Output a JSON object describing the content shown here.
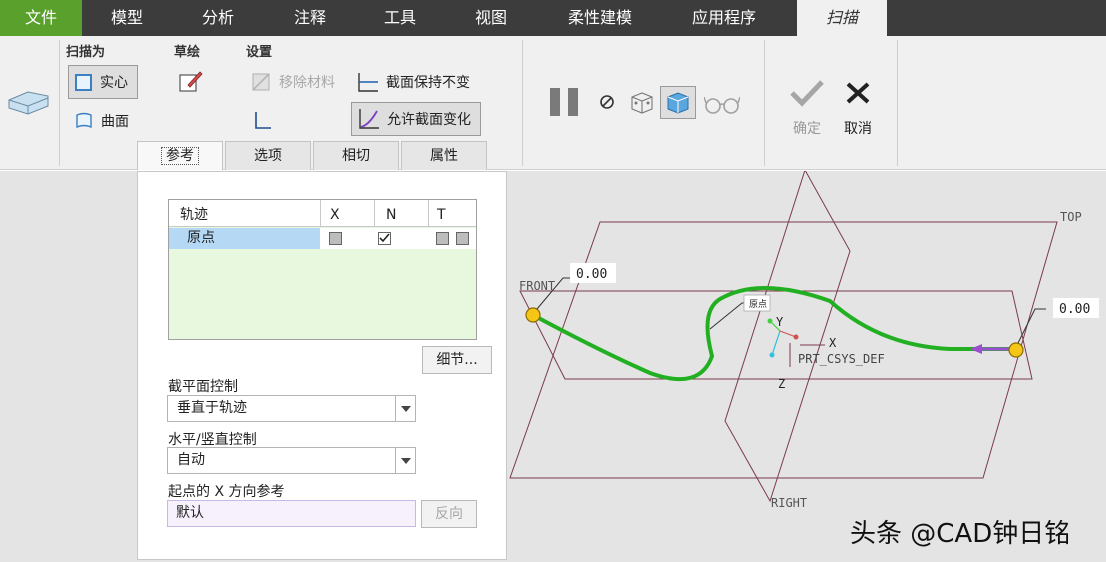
{
  "menu": {
    "file": "文件",
    "tabs": [
      "模型",
      "分析",
      "注释",
      "工具",
      "视图",
      "柔性建模",
      "应用程序"
    ],
    "active_tab": "扫描"
  },
  "ribbon": {
    "sweep_as": {
      "title": "扫描为",
      "solid": "实心",
      "surface": "曲面"
    },
    "sketch": {
      "title": "草绘"
    },
    "settings": {
      "title": "设置",
      "remove_material": "移除材料",
      "constant_section": "截面保持不变",
      "variable_section": "允许截面变化"
    },
    "confirm": "确定",
    "cancel": "取消",
    "subtabs": [
      "参考",
      "选项",
      "相切",
      "属性"
    ]
  },
  "panel": {
    "table": {
      "headers": [
        "轨迹",
        "X",
        "N",
        "T"
      ],
      "rows": [
        {
          "name": "原点",
          "x": false,
          "n": true,
          "t": [
            false,
            false
          ]
        }
      ]
    },
    "details_button": "细节...",
    "section_plane_label": "截平面控制",
    "section_plane_value": "垂直于轨迹",
    "hv_control_label": "水平/竖直控制",
    "hv_control_value": "自动",
    "start_x_label": "起点的 X 方向参考",
    "start_x_value": "默认",
    "flip_button": "反向"
  },
  "viewport": {
    "plane_front": "FRONT",
    "plane_top": "TOP",
    "plane_right": "RIGHT",
    "csys": "PRT_CSYS_DEF",
    "axis_x": "X",
    "axis_y": "Y",
    "axis_z": "Z",
    "dim_left": "0.00",
    "dim_right": "0.00",
    "origin_tag": "原点"
  },
  "colors": {
    "file_tab": "#5aa02c",
    "menubar": "#3c3c3c",
    "trajectory": "#22b022",
    "plane": "#7a3b4c",
    "endpoint": "#f5c518"
  },
  "watermark": "头条 @CAD钟日铭"
}
